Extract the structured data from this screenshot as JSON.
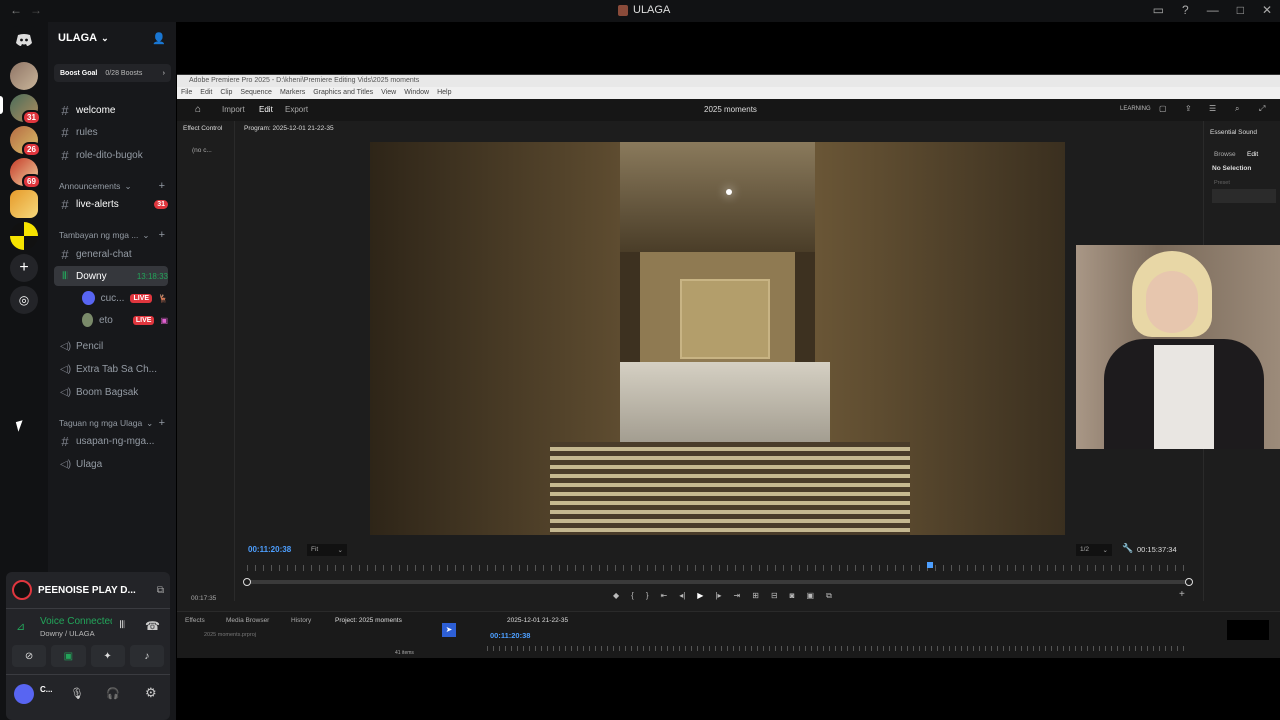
{
  "window": {
    "title": "ULAGA",
    "back": "←",
    "forward": "→"
  },
  "server": {
    "name": "ULAGA",
    "boost_goal": "Boost Goal",
    "boost_count": "0/28 Boosts"
  },
  "server_badges": [
    "31",
    "26",
    "69"
  ],
  "channels_top": [
    {
      "name": "welcome"
    },
    {
      "name": "rules"
    },
    {
      "name": "role-dito-bugok"
    }
  ],
  "cat_announcements": "Announcements",
  "live_alerts": {
    "name": "live-alerts",
    "count": "31"
  },
  "cat_tambayan": "Tambayan ng mga ...",
  "general_chat": "general-chat",
  "voice_channel": {
    "name": "Downy",
    "time": "13:18:33"
  },
  "voice_users": [
    {
      "name": "cuc...",
      "live": "LIVE"
    },
    {
      "name": "eto",
      "live": "LIVE"
    }
  ],
  "voice_others": [
    "Pencil",
    "Extra Tab Sa Ch...",
    "Boom Bagsak"
  ],
  "cat_taguan": "Taguan ng mga Ulaga",
  "taguan_channels": [
    "usapan-ng-mga...",
    "Ulaga"
  ],
  "stream_panel": {
    "title": "PEENOISE PLAY D..."
  },
  "voice_status": {
    "title": "Voice Connected",
    "sub": "Downy / ULAGA"
  },
  "user": {
    "name": "C..."
  },
  "premiere": {
    "window_title": "Adobe Premiere Pro 2025 - D:\\kheni\\Premiere Editing Vids\\2025 moments",
    "menu": [
      "File",
      "Edit",
      "Clip",
      "Sequence",
      "Markers",
      "Graphics and Titles",
      "View",
      "Window",
      "Help"
    ],
    "tabs": [
      "Import",
      "Edit",
      "Export"
    ],
    "project": "2025 moments",
    "learning": "LEARNING",
    "effect_controls": "Effect Control",
    "no_clip": "(no c...",
    "program": "Program: 2025-12-01 21-22-35",
    "timecode": "00:11:20:38",
    "fit": "Fit",
    "res": "1/2",
    "duration": "00:15:37:34",
    "essential": "Essential Sound",
    "browse": "Browse",
    "edit": "Edit",
    "no_selection": "No Selection",
    "preset": "Preset",
    "bottom_tabs": [
      "Effects",
      "Media Browser",
      "History",
      "Project: 2025 moments"
    ],
    "project_file": "2025 moments.prproj",
    "items": "41 items",
    "seq_name": "2025-12-01 21-22-35",
    "seq_tc": "00:11:20:38",
    "left_tc": "00:17:35"
  }
}
